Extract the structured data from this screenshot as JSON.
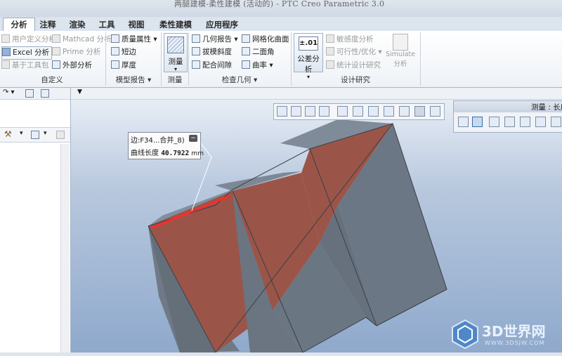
{
  "window": {
    "title": "两腿建模-柔性建模 (活动的) - PTC Creo Parametric 3.0"
  },
  "tabs": [
    "分析",
    "注释",
    "渲染",
    "工具",
    "视图",
    "柔性建模",
    "应用程序"
  ],
  "active_tab": "分析",
  "ribbon": {
    "custom": {
      "user_def": "用户定义分析",
      "excel": "Excel 分析",
      "toolkit": "基于工具包",
      "mathcad": "Mathcad 分析",
      "prime": "Prime 分析",
      "external": "外部分析",
      "group_label": "自定义"
    },
    "model_report": {
      "mass": "质量属性",
      "short_edge": "短边",
      "thickness": "厚度",
      "group_label": "模型报告"
    },
    "measure": {
      "label": "测量",
      "group_label": "测量"
    },
    "inspect": {
      "geom_report": "几何报告",
      "draft": "拔模斜度",
      "clearance": "配合间隙",
      "mesh": "网格化曲面",
      "dihedral": "二面角",
      "curvature": "曲率",
      "group_label": "检查几何"
    },
    "design": {
      "tolerance_icon": "±.01",
      "tolerance": "公差分析",
      "sensitivity": "敏感度分析",
      "feasibility": "可行性/优化",
      "stat_design": "统计设计研究",
      "simulate": "Simulate",
      "simulate_sub": "分析",
      "group_label": "设计研究"
    }
  },
  "measure_panel": {
    "title": "测量 : 长度"
  },
  "callout": {
    "edge_label": "边:F34...合并_8)",
    "length_label": "曲线长度",
    "length_value": "40.7922",
    "unit": "mm"
  },
  "watermark": {
    "brand": "3D世界网",
    "url": "WWW.3DSJW.COM"
  }
}
